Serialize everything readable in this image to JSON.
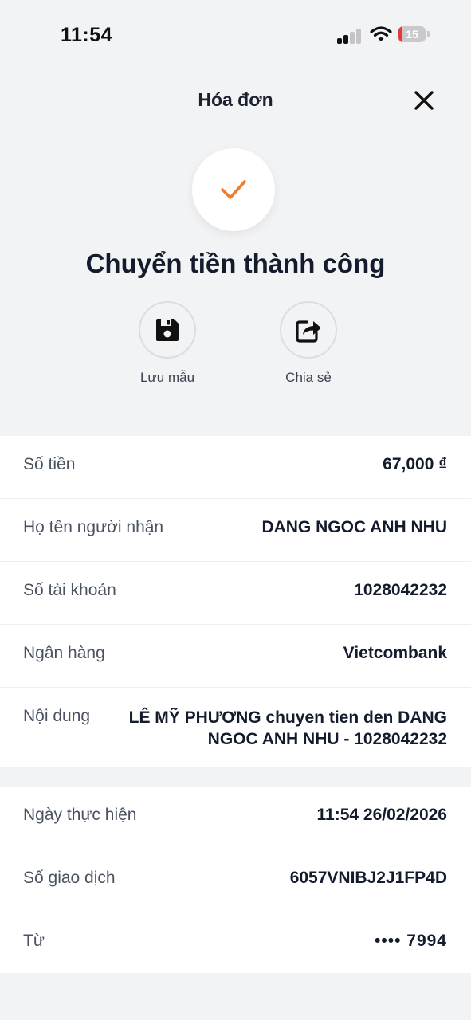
{
  "status_bar": {
    "time": "11:54",
    "battery": "15",
    "battery_level_percent": 15
  },
  "header": {
    "title": "Hóa đơn"
  },
  "success": {
    "title": "Chuyển tiền thành công"
  },
  "actions": [
    {
      "label": "Lưu mẫu",
      "icon": "floppy-disk-icon"
    },
    {
      "label": "Chia sẻ",
      "icon": "share-icon"
    }
  ],
  "details": [
    {
      "label": "Số tiền",
      "value": "67,000 ₫"
    },
    {
      "label": "Họ tên người nhận",
      "value": "DANG NGOC ANH NHU"
    },
    {
      "label": "Số tài khoản",
      "value": "1028042232"
    },
    {
      "label": "Ngân hàng",
      "value": "Vietcombank"
    },
    {
      "label": "Nội dung",
      "value": "LÊ MỸ PHƯƠNG chuyen tien den DANG NGOC ANH NHU - 1028042232"
    }
  ],
  "transaction": [
    {
      "label": "Ngày thực hiện",
      "value": "11:54 26/02/2026"
    },
    {
      "label": "Số giao dịch",
      "value": "6057VNIBJ2J1FP4D"
    },
    {
      "label": "Từ",
      "value": "•••• 7994"
    }
  ],
  "colors": {
    "accent": "#f07c2c",
    "text": "#141b2d",
    "background": "#f2f3f5",
    "battery_low": "#e5383b"
  }
}
